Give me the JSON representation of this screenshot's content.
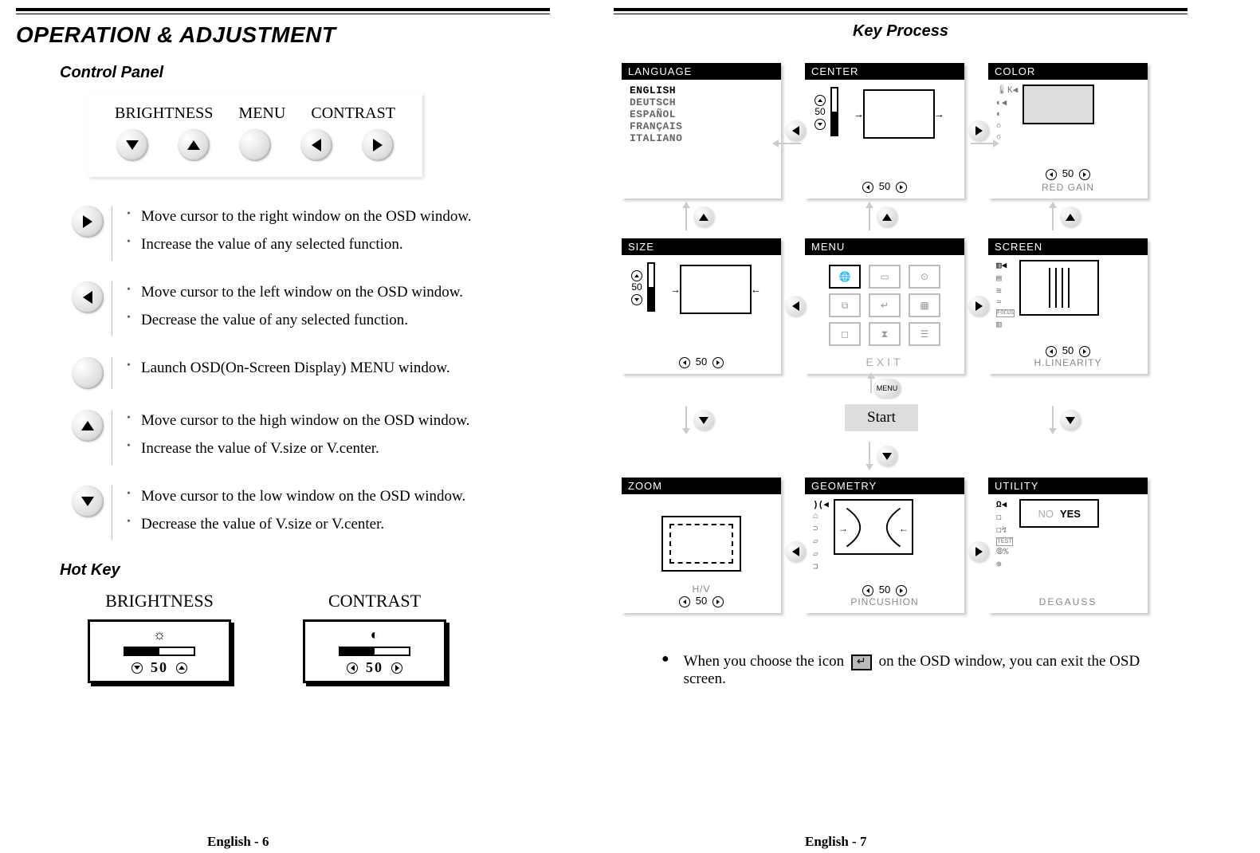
{
  "left": {
    "top_title": "OPERATION & ADJUSTMENT",
    "control_panel_title": "Control Panel",
    "control_card": {
      "label_brightness": "BRIGHTNESS",
      "label_menu": "MENU",
      "label_contrast": "CONTRAST"
    },
    "defs": [
      {
        "icon": "right",
        "lines": [
          "Move cursor to the right window on the OSD window.",
          "Increase the value of any selected function."
        ]
      },
      {
        "icon": "left",
        "lines": [
          "Move cursor to the left window on the OSD window.",
          "Decrease the value of any selected  function."
        ]
      },
      {
        "icon": "blank",
        "lines": [
          "Launch OSD(On-Screen Display) MENU window."
        ]
      },
      {
        "icon": "up",
        "lines": [
          "Move cursor to the high window on the OSD window.",
          "Increase the value of V.size or V.center."
        ]
      },
      {
        "icon": "down",
        "lines": [
          "Move cursor to the low window on the OSD window.",
          "Decrease the value of V.size or V.center."
        ]
      }
    ],
    "hot_key_title": "Hot Key",
    "hotkeys": {
      "brightness_label": "BRIGHTNESS",
      "brightness_value": "50",
      "contrast_label": "CONTRAST",
      "contrast_value": "50"
    },
    "footer": "English - 6"
  },
  "right": {
    "key_process_title": "Key Process",
    "cards": {
      "language": {
        "title": "LANGUAGE",
        "items": [
          "ENGLISH",
          "DEUTSCH",
          "ESPAÑOL",
          "FRANÇAIS",
          "ITALIANO"
        ]
      },
      "center": {
        "title": "CENTER",
        "v_value": "50",
        "h_value": "50"
      },
      "color": {
        "title": "COLOR",
        "value": "50",
        "footer": "RED GAIN"
      },
      "size": {
        "title": "SIZE",
        "v_value": "50",
        "h_value": "50"
      },
      "menu": {
        "title": "MENU",
        "exit_label": "EXIT"
      },
      "screen": {
        "title": "SCREEN",
        "value": "50",
        "footer": "H.LINEARITY"
      },
      "zoom": {
        "title": "ZOOM",
        "sub": "H/V",
        "value": "50"
      },
      "geometry": {
        "title": "GEOMETRY",
        "value": "50",
        "footer": "PINCUSHION"
      },
      "utility": {
        "title": "UTILITY",
        "no": "NO",
        "yes": "YES",
        "footer": "DEGAUSS"
      }
    },
    "menu_button_label": "MENU",
    "start_label": "Start",
    "note_text_before": "When you choose the icon ",
    "note_text_after": " on the OSD window, you can exit the OSD screen.",
    "footer": "English - 7"
  }
}
